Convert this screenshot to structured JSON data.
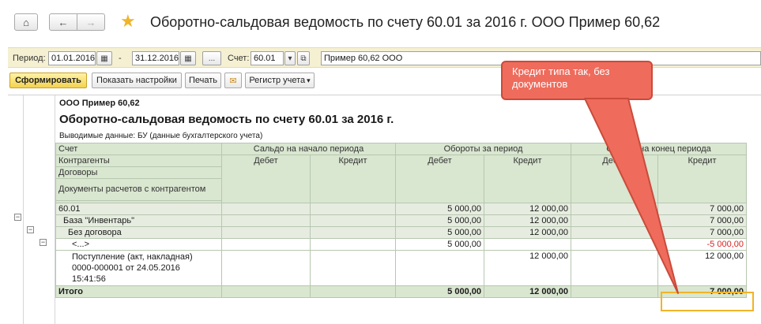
{
  "window": {
    "title": "Оборотно-сальдовая ведомость по счету 60.01 за 2016 г. ООО Пример 60,62"
  },
  "nav": {
    "home": "⌂",
    "back": "←",
    "forward": "→",
    "favorite": "★"
  },
  "filters": {
    "period_label": "Период:",
    "period_from": "01.01.2016",
    "period_dash": "-",
    "period_to": "31.12.2016",
    "more": "...",
    "account_label": "Счет:",
    "account": "60.01",
    "organization": "Пример 60,62 ООО"
  },
  "toolbar": {
    "generate": "Сформировать",
    "settings": "Показать настройки",
    "print": "Печать",
    "register": "Регистр учета"
  },
  "report": {
    "org": "ООО Пример 60,62",
    "title": "Оборотно-сальдовая ведомость по счету 60.01 за 2016 г.",
    "data_shown": "Выводимые данные:  БУ (данные бухгалтерского учета)",
    "headers": {
      "account": "Счет",
      "counterparty": "Контрагенты",
      "contracts": "Договоры",
      "docs": "Документы расчетов с контрагентом",
      "opening": "Сальдо на начало периода",
      "turnover": "Обороты за период",
      "closing": "Сальдо на конец периода",
      "debit": "Дебет",
      "credit": "Кредит"
    },
    "rows": [
      {
        "name": "60.01",
        "turn_debit": "5 000,00",
        "turn_credit": "12 000,00",
        "close_credit": "7 000,00"
      },
      {
        "name": "База \"Инвентарь\"",
        "turn_debit": "5 000,00",
        "turn_credit": "12 000,00",
        "close_credit": "7 000,00"
      },
      {
        "name": "Без договора",
        "turn_debit": "5 000,00",
        "turn_credit": "12 000,00",
        "close_credit": "7 000,00"
      },
      {
        "name": "<...>",
        "turn_debit": "5 000,00",
        "turn_credit": "",
        "close_credit": "-5 000,00"
      },
      {
        "name_l1": "Поступление (акт, накладная)",
        "name_l2": "0000-000001 от 24.05.2016",
        "name_l3": "15:41:56",
        "turn_debit": "",
        "turn_credit": "12 000,00",
        "close_credit": "12 000,00"
      }
    ],
    "total": {
      "label": "Итого",
      "turn_debit": "5 000,00",
      "turn_credit": "12 000,00",
      "close_credit": "7 000,00"
    }
  },
  "callout": {
    "text": "Кредит типа так, без документов"
  },
  "colors": {
    "header_bg": "#d9e6d0",
    "callout_bg": "#ef6b5c",
    "highlight": "#f0b429",
    "negative": "#dd2222"
  }
}
